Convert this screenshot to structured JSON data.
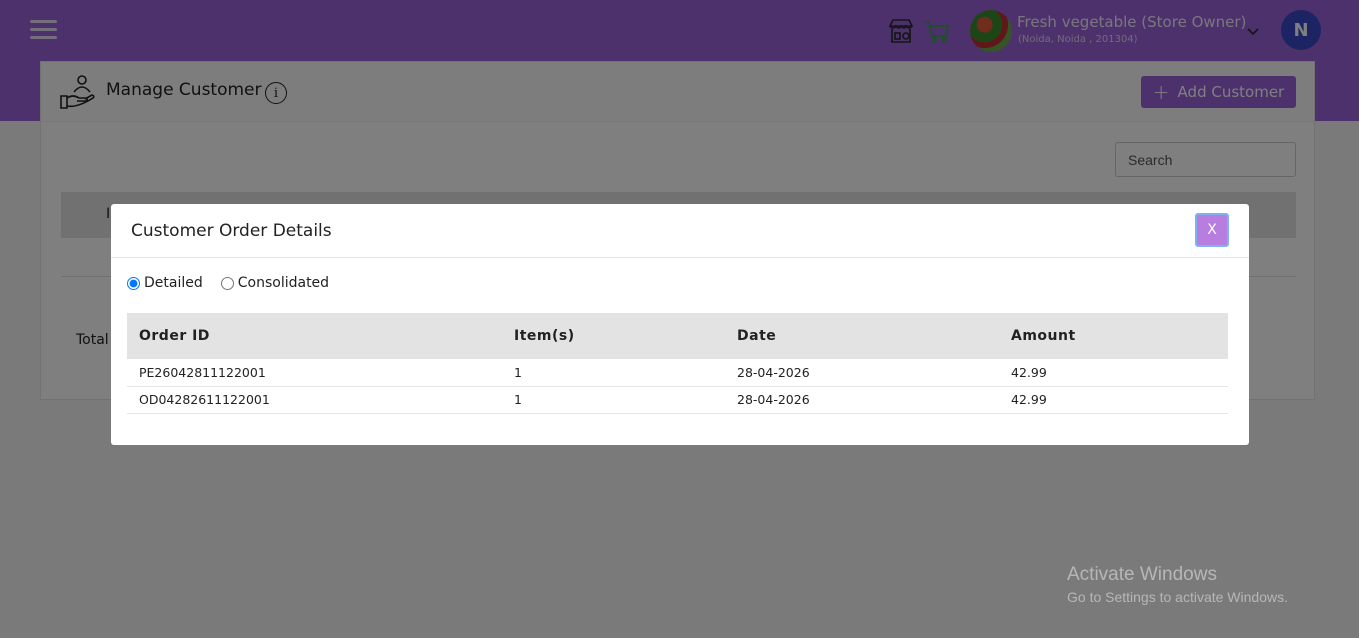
{
  "header": {
    "store_name": "Fresh vegetable (Store Owner)",
    "store_location": "(Noida, Noida , 201304)",
    "user_initial": "N",
    "icons": [
      "menu-icon",
      "store-icon",
      "cart-icon",
      "chevron-down-icon"
    ]
  },
  "page": {
    "title": "Manage Customer",
    "info_glyph": "i",
    "add_button_label": "Add Customer",
    "search_placeholder": "Search",
    "partial_column": "I",
    "partial_total": "Total"
  },
  "modal": {
    "title": "Customer Order Details",
    "close_label": "X",
    "view_options": [
      "Detailed",
      "Consolidated"
    ],
    "selected_view": "Detailed",
    "columns": [
      "Order ID",
      "Item(s)",
      "Date",
      "Amount"
    ],
    "rows": [
      [
        "PE26042811122001",
        "1",
        "28-04-2026",
        "42.99"
      ],
      [
        "OD04282611122001",
        "1",
        "28-04-2026",
        "42.99"
      ]
    ]
  },
  "watermark": {
    "title": "Activate Windows",
    "subtitle": "Go to Settings to activate Windows."
  },
  "colors": {
    "brand": "#9b62d8",
    "avatar": "#3a49c9",
    "close_button": "#b77ee0"
  }
}
